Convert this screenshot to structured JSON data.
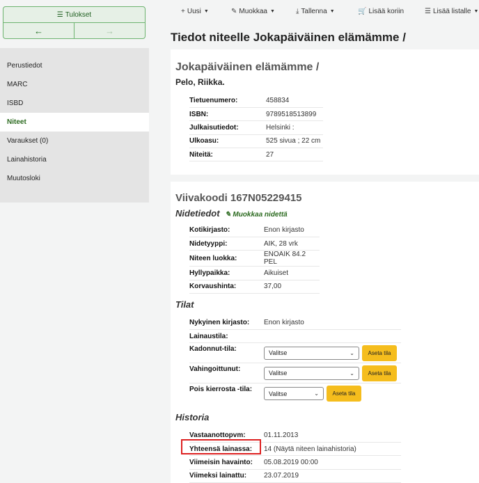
{
  "sidebar": {
    "results_label": "Tulokset",
    "prev_arrow": "←",
    "next_arrow": "→",
    "items": [
      {
        "label": "Perustiedot"
      },
      {
        "label": "MARC"
      },
      {
        "label": "ISBD"
      },
      {
        "label": "Niteet"
      },
      {
        "label": "Varaukset (0)"
      },
      {
        "label": "Lainahistoria"
      },
      {
        "label": "Muutosloki"
      }
    ]
  },
  "toolbar": {
    "new_label": "Uusi",
    "edit_label": "Muokkaa",
    "save_label": "Tallenna",
    "cart_label": "Lisää koriin",
    "list_label": "Lisää listalle"
  },
  "page_title": "Tiedot niteelle Jokapäiväinen elämämme /",
  "record": {
    "title": "Jokapäiväinen elämämme /",
    "author": "Pelo, Riikka.",
    "fields": [
      {
        "label": "Tietuenumero:",
        "value": "458834"
      },
      {
        "label": "ISBN:",
        "value": "9789518513899"
      },
      {
        "label": "Julkaisutiedot:",
        "value": "Helsinki :"
      },
      {
        "label": "Ulkoasu:",
        "value": "525 sivua ; 22 cm"
      },
      {
        "label": "Niteitä:",
        "value": "27"
      }
    ]
  },
  "item": {
    "barcode_heading": "Viivakoodi 167N05229415",
    "details_heading": "Nidetiedot",
    "edit_item_label": "Muokkaa nidettä",
    "fields": [
      {
        "label": "Kotikirjasto:",
        "value": "Enon kirjasto"
      },
      {
        "label": "Nidetyyppi:",
        "value": "AIK, 28 vrk"
      },
      {
        "label": "Niteen luokka:",
        "value": "ENOAIK 84.2 PEL"
      },
      {
        "label": "Hyllypaikka:",
        "value": "Aikuiset"
      },
      {
        "label": "Korvaushinta:",
        "value": "37,00"
      }
    ]
  },
  "statuses": {
    "heading": "Tilat",
    "current_library_label": "Nykyinen kirjasto:",
    "current_library_value": "Enon kirjasto",
    "loan_status_label": "Lainaustila:",
    "lost_label": "Kadonnut-tila:",
    "lost_value": "Valitse",
    "damaged_label": "Vahingoittunut:",
    "damaged_value": "Valitse",
    "withdrawn_label": "Pois kierrosta -tila:",
    "withdrawn_value": "Valitse",
    "set_button_label": "Aseta tila"
  },
  "history": {
    "heading": "Historia",
    "fields": [
      {
        "label": "Vastaanottopvm:",
        "value": "01.11.2013"
      },
      {
        "label": "Yhteensä lainassa:",
        "value": "14 (Näytä niteen lainahistoria)"
      },
      {
        "label": "Viimeisin havainto:",
        "value": "05.08.2019 00:00"
      },
      {
        "label": "Viimeksi lainattu:",
        "value": "23.07.2019"
      }
    ]
  },
  "colors": {
    "accent_green": "#2b6a1f",
    "button_yellow": "#f5bd1d",
    "highlight_red": "#dd2020"
  }
}
